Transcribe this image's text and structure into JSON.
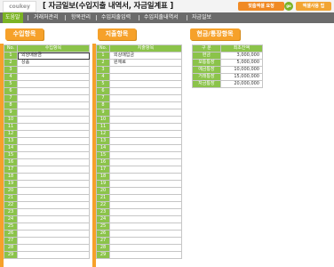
{
  "header": {
    "logo_text": "coukey",
    "title": "[ 자금일보(수입지출 내역서, 자금일계표 ]",
    "custom_request_label": "맞춤엑셀 요청",
    "badge_label": "go",
    "tips_label": "엑셀사용 팁"
  },
  "menu": {
    "items": [
      "도움말",
      "거래처관리",
      "항목관리",
      "수입지출입력",
      "수입지출내역서",
      "자금일보"
    ],
    "active_index": 0
  },
  "income": {
    "heading": "수입항목",
    "col_no": "No.",
    "col_item": "수입항목",
    "rows": [
      "외상매출금",
      "상품",
      "",
      "",
      "",
      "",
      "",
      "",
      "",
      "",
      "",
      "",
      "",
      "",
      "",
      "",
      "",
      "",
      "",
      "",
      "",
      "",
      "",
      "",
      "",
      "",
      "",
      "",
      ""
    ],
    "selected_row": 0
  },
  "expense": {
    "heading": "지출항목",
    "col_no": "No.",
    "col_item": "지출항목",
    "rows": [
      "외상매입금",
      "원재료",
      "",
      "",
      "",
      "",
      "",
      "",
      "",
      "",
      "",
      "",
      "",
      "",
      "",
      "",
      "",
      "",
      "",
      "",
      "",
      "",
      "",
      "",
      "",
      "",
      "",
      "",
      ""
    ]
  },
  "cash": {
    "heading": "현금/통장항목",
    "col_type": "구 분",
    "col_balance": "최초잔액",
    "rows": [
      {
        "label": "현금",
        "amount": "3,000,000"
      },
      {
        "label": "보통통장",
        "amount": "5,000,000"
      },
      {
        "label": "예금통장",
        "amount": "10,000,000"
      },
      {
        "label": "거래통장",
        "amount": "15,000,000"
      },
      {
        "label": "자금통장",
        "amount": "20,000,000"
      }
    ]
  },
  "colors": {
    "accent_green": "#8bc34a",
    "accent_orange": "#f6a12a",
    "menubar": "#6b6b6b"
  }
}
